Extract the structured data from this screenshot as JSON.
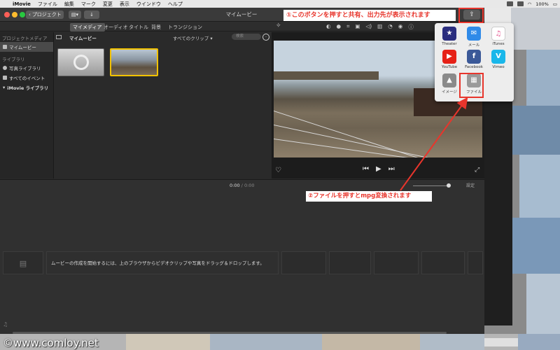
{
  "menubar": {
    "app": "iMovie",
    "items": [
      "ファイル",
      "編集",
      "マーク",
      "変更",
      "表示",
      "ウインドウ",
      "ヘルプ"
    ],
    "right_status": "100%"
  },
  "toolbar": {
    "back_label": "プロジェクト",
    "title": "マイムービー"
  },
  "tabs": [
    "マイメディア",
    "オーディオ",
    "タイトル",
    "背景",
    "トランジション"
  ],
  "sidebar": {
    "section1": "プロジェクトメディア",
    "project_item": "マイムービー",
    "section2": "ライブラリ",
    "lib_items": [
      "写真ライブラリ",
      "すべてのイベント"
    ],
    "library": "iMovie ライブラリ"
  },
  "browser": {
    "title": "マイムービー",
    "filter": "すべてのクリップ",
    "search_placeholder": "検索"
  },
  "timeline": {
    "time_current": "0:00",
    "time_sep": " / ",
    "time_total": "0:00",
    "settings": "設定",
    "empty_message": "ムービーの作成を開始するには、上のブラウザからビデオクリップや写真をドラッグ＆ドロップします。"
  },
  "share_popup": {
    "items": [
      {
        "label": "Theater",
        "icon": "theater-icon",
        "color": "#2a2d7e",
        "glyph": "★"
      },
      {
        "label": "メール",
        "icon": "mail-icon",
        "color": "#2f8ae8",
        "glyph": "✉"
      },
      {
        "label": "iTunes",
        "icon": "itunes-icon",
        "color": "#ffffff",
        "glyph": "♫"
      },
      {
        "label": "YouTube",
        "icon": "youtube-icon",
        "color": "#e62117",
        "glyph": "▶"
      },
      {
        "label": "Facebook",
        "icon": "facebook-icon",
        "color": "#3b5998",
        "glyph": "f"
      },
      {
        "label": "Vimeo",
        "icon": "vimeo-icon",
        "color": "#1ab7ea",
        "glyph": "V"
      },
      {
        "label": "イメージ",
        "icon": "image-icon",
        "color": "#8a8a8a",
        "glyph": "▲"
      },
      {
        "label": "ファイル",
        "icon": "file-icon",
        "color": "#9a9a9a",
        "glyph": "▦"
      }
    ]
  },
  "annotations": {
    "step1": "①このボタンを押すと共有、出力先が表示されます",
    "step2": "②ファイルを押すとmpg変換されます"
  },
  "watermark": "©www.comloy.net",
  "colors": {
    "annotation_red": "#e8352c",
    "clip_selected": "#f2c200"
  }
}
